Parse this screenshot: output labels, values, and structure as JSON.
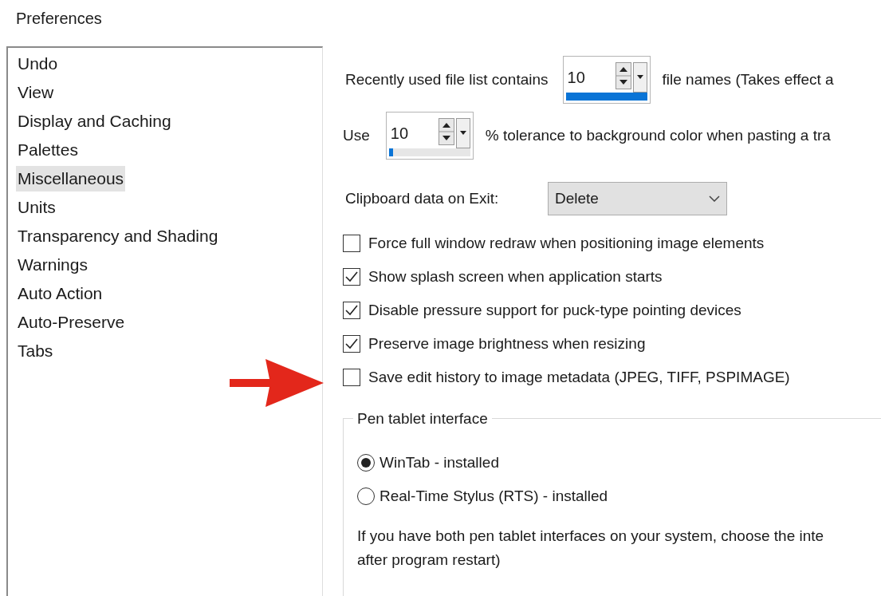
{
  "window": {
    "title": "Preferences"
  },
  "sidebar": {
    "items": [
      {
        "label": "Undo",
        "selected": false
      },
      {
        "label": "View",
        "selected": false
      },
      {
        "label": "Display and Caching",
        "selected": false
      },
      {
        "label": "Palettes",
        "selected": false
      },
      {
        "label": "Miscellaneous",
        "selected": true
      },
      {
        "label": "Units",
        "selected": false
      },
      {
        "label": "Transparency and Shading",
        "selected": false
      },
      {
        "label": "Warnings",
        "selected": false
      },
      {
        "label": "Auto Action",
        "selected": false
      },
      {
        "label": "Auto-Preserve",
        "selected": false
      },
      {
        "label": "Tabs",
        "selected": false
      }
    ]
  },
  "spin_rows": [
    {
      "label": "Recently used file list contains",
      "value": "10",
      "level": 1,
      "suffix": "file names (Takes effect a"
    },
    {
      "label": "Use",
      "value": "10",
      "level": 0.05,
      "suffix": "% tolerance to background color when pasting a tra"
    }
  ],
  "clipboard": {
    "label": "Clipboard data on Exit:",
    "value": "Delete"
  },
  "checkboxes": [
    {
      "label": "Force full window redraw when positioning image elements",
      "checked": false
    },
    {
      "label": "Show splash screen when application starts",
      "checked": true
    },
    {
      "label": "Disable pressure support for puck-type pointing devices",
      "checked": true
    },
    {
      "label": "Preserve image brightness when resizing",
      "checked": true
    },
    {
      "label": "Save edit history to image metadata (JPEG, TIFF, PSPIMAGE)",
      "checked": false
    }
  ],
  "pen_tablet": {
    "title": "Pen tablet interface",
    "options": [
      {
        "label": "WinTab - installed",
        "selected": true
      },
      {
        "label": "Real-Time Stylus (RTS) - installed",
        "selected": false
      }
    ],
    "note_lines": [
      "If you have both pen tablet interfaces on your system, choose the inte",
      "after program restart)"
    ]
  }
}
